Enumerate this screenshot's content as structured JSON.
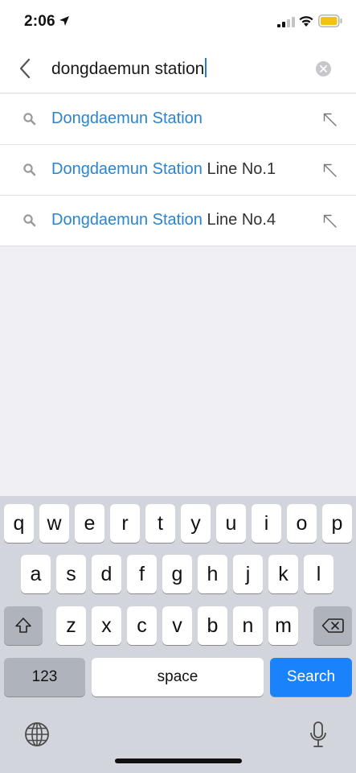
{
  "status": {
    "time": "2:06",
    "location_icon": "location-arrow-icon",
    "signal_icon": "cellular-signal-icon",
    "wifi_icon": "wifi-icon",
    "battery_icon": "battery-icon",
    "battery_color": "#f2c21b"
  },
  "search": {
    "query": "dongdaemun station",
    "back_icon": "chevron-left-icon",
    "clear_icon": "clear-circle-icon"
  },
  "suggestions": [
    {
      "match": "Dongdaemun Station",
      "rest": ""
    },
    {
      "match": "Dongdaemun Station",
      "rest": " Line No.1"
    },
    {
      "match": "Dongdaemun Station",
      "rest": " Line No.4"
    }
  ],
  "colors": {
    "match_text": "#2b84cf",
    "search_key": "#1a82fb"
  },
  "keyboard": {
    "row1": [
      "q",
      "w",
      "e",
      "r",
      "t",
      "y",
      "u",
      "i",
      "o",
      "p"
    ],
    "row2": [
      "a",
      "s",
      "d",
      "f",
      "g",
      "h",
      "j",
      "k",
      "l"
    ],
    "row3": [
      "z",
      "x",
      "c",
      "v",
      "b",
      "n",
      "m"
    ],
    "numbers_label": "123",
    "space_label": "space",
    "search_label": "Search",
    "shift_icon": "shift-icon",
    "delete_icon": "backspace-icon",
    "globe_icon": "globe-icon",
    "mic_icon": "microphone-icon"
  }
}
